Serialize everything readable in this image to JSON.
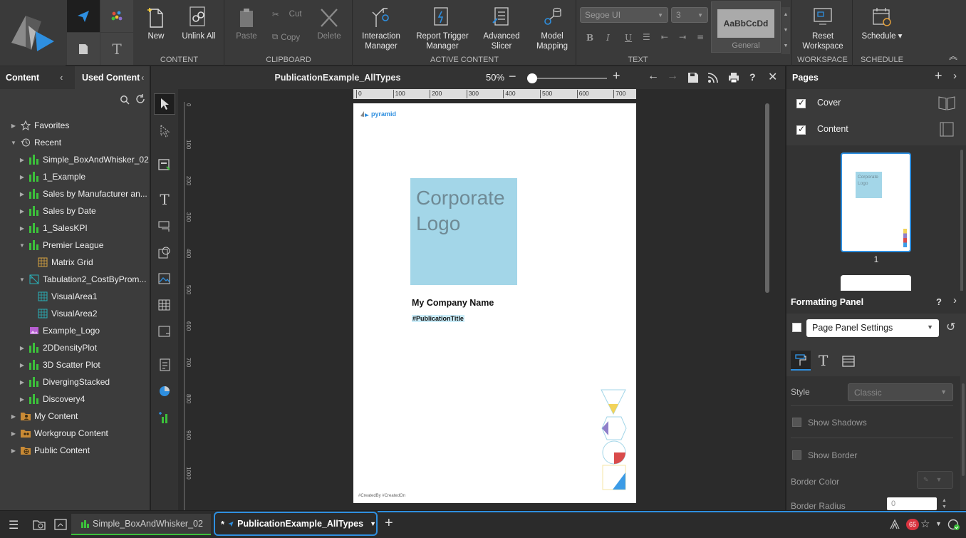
{
  "ribbon": {
    "groups": {
      "content": "CONTENT",
      "clipboard": "CLIPBOARD",
      "active_content": "ACTIVE CONTENT",
      "text": "TEXT",
      "workspace": "WORKSPACE",
      "schedule": "SCHEDULE"
    },
    "buttons": {
      "new": "New",
      "unlink_all": "Unlink All",
      "paste": "Paste",
      "cut": "Cut",
      "copy": "Copy",
      "delete": "Delete",
      "interaction_manager": "Interaction Manager",
      "report_trigger_manager": "Report Trigger Manager",
      "advanced_slicer": "Advanced Slicer",
      "model_mapping": "Model Mapping",
      "reset_workspace": "Reset Workspace",
      "schedule": "Schedule ▾"
    },
    "font_name": "Segoe UI",
    "font_size": "3",
    "style_preview": "AaBbCcDd",
    "style_name": "General"
  },
  "left_panel": {
    "tabs": {
      "content": "Content",
      "used_content": "Used Content"
    },
    "tree": [
      {
        "label": "Favorites",
        "icon": "star-icon",
        "level": 0,
        "expand": "closed"
      },
      {
        "label": "Recent",
        "icon": "history-icon",
        "level": 0,
        "expand": "open"
      },
      {
        "label": "Simple_BoxAndWhisker_02",
        "icon": "chart-icon",
        "level": 1,
        "expand": "closed"
      },
      {
        "label": "1_Example",
        "icon": "chart-icon",
        "level": 1,
        "expand": "closed"
      },
      {
        "label": "Sales by Manufacturer an...",
        "icon": "chart-icon",
        "level": 1,
        "expand": "closed"
      },
      {
        "label": "Sales by Date",
        "icon": "chart-icon",
        "level": 1,
        "expand": "closed"
      },
      {
        "label": "1_SalesKPI",
        "icon": "chart-icon",
        "level": 1,
        "expand": "closed"
      },
      {
        "label": "Premier League",
        "icon": "chart-icon",
        "level": 1,
        "expand": "open"
      },
      {
        "label": "Matrix Grid",
        "icon": "grid-icon",
        "level": 2,
        "expand": "none"
      },
      {
        "label": "Tabulation2_CostByProm...",
        "icon": "tabulation-icon",
        "level": 1,
        "expand": "open"
      },
      {
        "label": "VisualArea1",
        "icon": "grid-teal-icon",
        "level": 2,
        "expand": "none"
      },
      {
        "label": "VisualArea2",
        "icon": "grid-teal-icon",
        "level": 2,
        "expand": "none"
      },
      {
        "label": "Example_Logo",
        "icon": "image-icon",
        "level": 1,
        "expand": "none"
      },
      {
        "label": "2DDensityPlot",
        "icon": "chart-icon",
        "level": 1,
        "expand": "closed"
      },
      {
        "label": "3D Scatter Plot",
        "icon": "chart-icon",
        "level": 1,
        "expand": "closed"
      },
      {
        "label": "DivergingStacked",
        "icon": "chart-icon",
        "level": 1,
        "expand": "closed"
      },
      {
        "label": "Discovery4",
        "icon": "chart-icon",
        "level": 1,
        "expand": "closed"
      },
      {
        "label": "My Content",
        "icon": "user-folder-icon",
        "level": 0,
        "expand": "closed"
      },
      {
        "label": "Workgroup Content",
        "icon": "group-folder-icon",
        "level": 0,
        "expand": "closed"
      },
      {
        "label": "Public Content",
        "icon": "public-folder-icon",
        "level": 0,
        "expand": "closed"
      }
    ]
  },
  "document": {
    "title": "PublicationExample_AllTypes",
    "zoom": "50%",
    "ruler_h": [
      "0",
      "100",
      "200",
      "300",
      "400",
      "500",
      "600",
      "700"
    ],
    "ruler_v": [
      "0",
      "100",
      "200",
      "300",
      "400",
      "500",
      "600",
      "700",
      "800",
      "900",
      "1000"
    ],
    "page": {
      "brand": "pyramid",
      "logo_text_1": "Corporate",
      "logo_text_2": "Logo",
      "company": "My Company Name",
      "pub_title": "#PublicationTitle",
      "footer": "#CreatedBy #CreatedOn"
    }
  },
  "pages_panel": {
    "title": "Pages",
    "items": [
      {
        "label": "Cover",
        "checked": true
      },
      {
        "label": "Content",
        "checked": true
      }
    ],
    "thumb_text_1": "Corporate",
    "thumb_text_2": "Logo",
    "thumb_number": "1"
  },
  "formatting_panel": {
    "title": "Formatting Panel",
    "selector": "Page Panel Settings",
    "style_label": "Style",
    "style_value": "Classic",
    "show_shadows": "Show Shadows",
    "show_border": "Show Border",
    "border_color": "Border Color",
    "border_radius": "Border Radius",
    "border_radius_value": "0"
  },
  "bottom_bar": {
    "tabs": [
      {
        "label": "Simple_BoxAndWhisker_02"
      },
      {
        "label": "PublicationExample_AllTypes"
      }
    ],
    "unsaved_marker": "*",
    "notification_count": "65"
  },
  "colors": {
    "accent": "#2e8fe0",
    "chart_green": "#3cc13b",
    "logo_box": "#a3d6e8",
    "logo_text": "#6f8a95",
    "active_tab": "#2e8fe0"
  }
}
